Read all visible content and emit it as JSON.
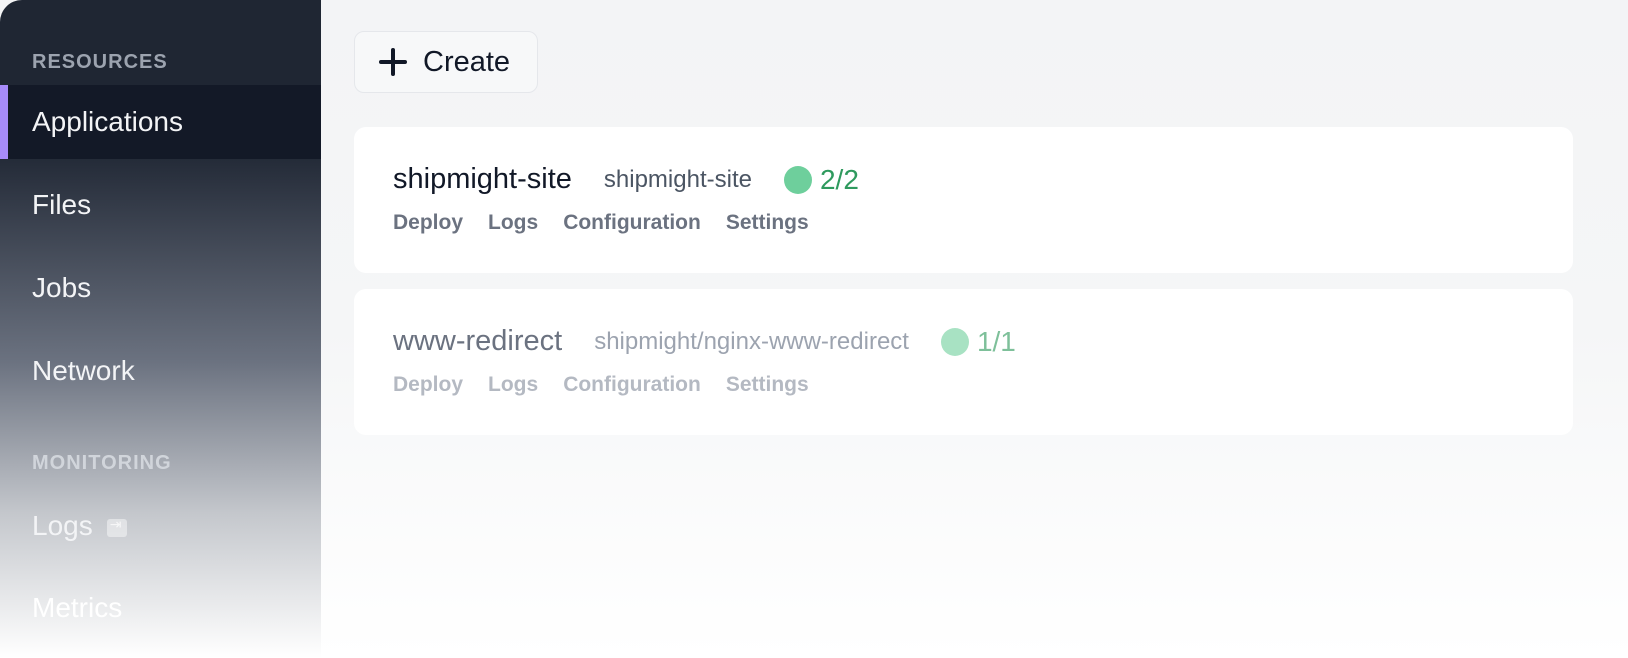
{
  "sidebar": {
    "resources_label": "RESOURCES",
    "monitoring_label": "MONITORING",
    "items": [
      {
        "label": "Applications"
      },
      {
        "label": "Files"
      },
      {
        "label": "Jobs"
      },
      {
        "label": "Network"
      },
      {
        "label": "Logs"
      },
      {
        "label": "Metrics"
      }
    ],
    "accent_color": "#a78bfa"
  },
  "toolbar": {
    "create_label": "Create"
  },
  "applications": [
    {
      "name": "shipmight-site",
      "image": "shipmight-site",
      "status": "2/2",
      "actions": [
        "Deploy",
        "Logs",
        "Configuration",
        "Settings"
      ]
    },
    {
      "name": "www-redirect",
      "image": "shipmight/nginx-www-redirect",
      "status": "1/1",
      "actions": [
        "Deploy",
        "Logs",
        "Configuration",
        "Settings"
      ]
    }
  ],
  "colors": {
    "status_ok": "#6ecf9c",
    "sidebar_bg": "#1f2633"
  }
}
